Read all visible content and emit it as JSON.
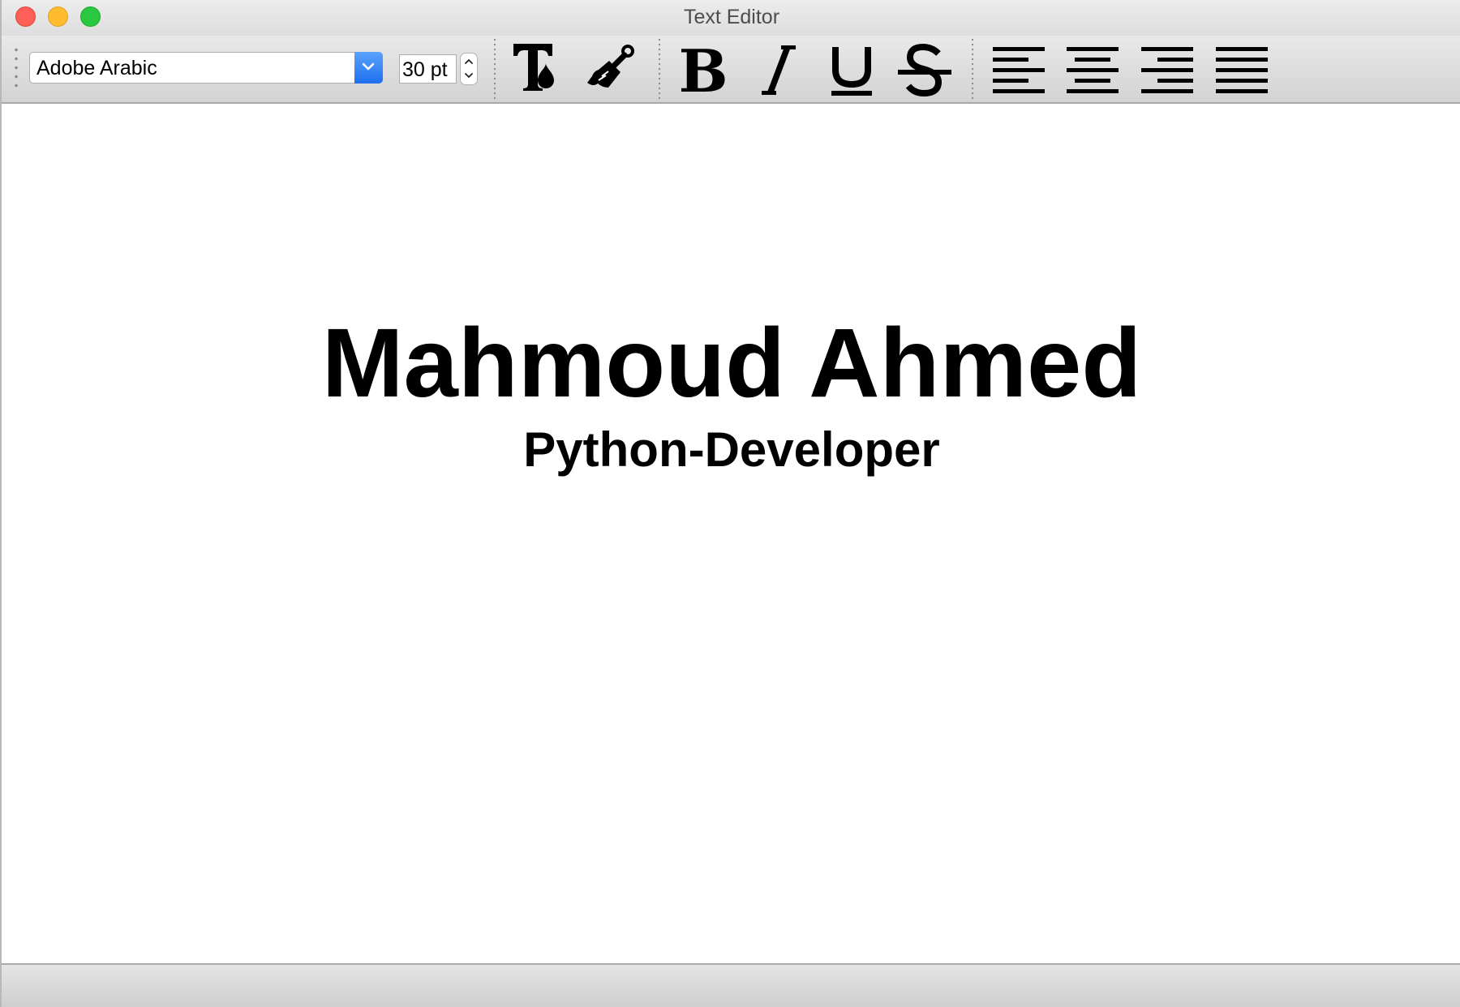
{
  "window": {
    "title": "Text Editor"
  },
  "toolbar": {
    "font_family": "Adobe Arabic",
    "font_size": "30 pt"
  },
  "document": {
    "title": "Mahmoud Ahmed",
    "subtitle": "Python-Developer"
  },
  "icons": {
    "text_color": "text-color-icon",
    "highlight": "paint-brush-icon",
    "bold": "bold-icon",
    "italic": "italic-icon",
    "underline": "underline-icon",
    "strikethrough": "strikethrough-icon",
    "align_left": "align-left-icon",
    "align_center": "align-center-icon",
    "align_right": "align-right-icon",
    "align_justify": "align-justify-icon"
  },
  "colors": {
    "close": "#fe5f57",
    "minimize": "#febc2e",
    "maximize": "#28c840",
    "accent": "#2a7bf2"
  }
}
